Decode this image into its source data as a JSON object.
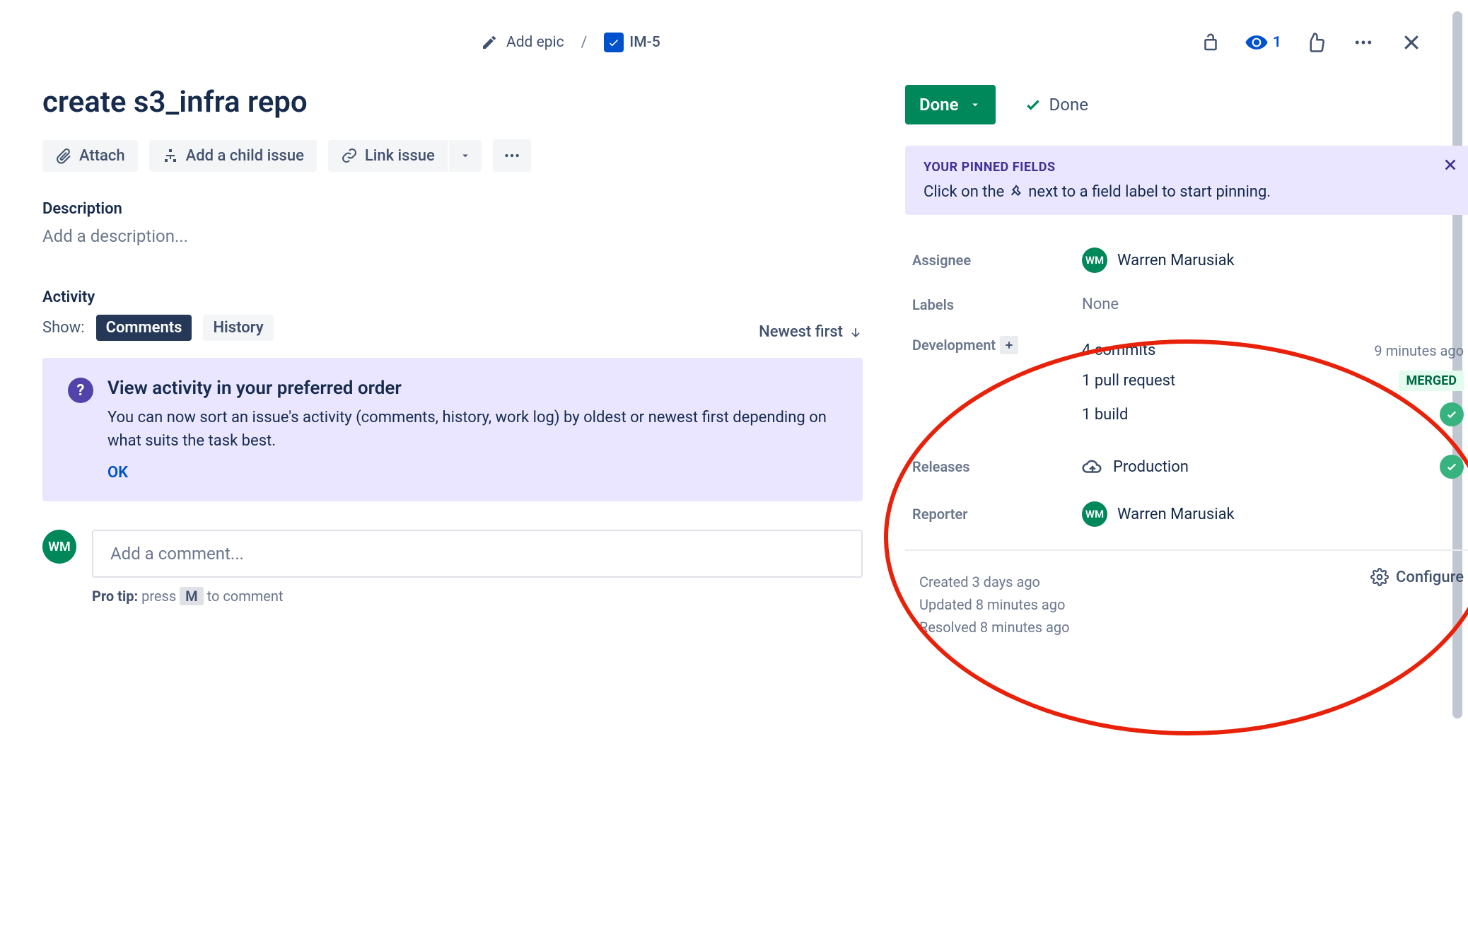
{
  "breadcrumb": {
    "add_epic": "Add epic",
    "issue_key": "IM-5"
  },
  "header_actions": {
    "watch_count": "1"
  },
  "issue": {
    "title": "create s3_infra repo",
    "actions": {
      "attach": "Attach",
      "child": "Add a child issue",
      "link": "Link issue"
    },
    "description_label": "Description",
    "description_placeholder": "Add a description..."
  },
  "activity": {
    "title": "Activity",
    "show_label": "Show:",
    "tabs": {
      "comments": "Comments",
      "history": "History"
    },
    "sort": "Newest first"
  },
  "banner": {
    "title": "View activity in your preferred order",
    "body": "You can now sort an issue's activity (comments, history, work log) by oldest or newest first depending on what suits the task best.",
    "ok": "OK"
  },
  "comment": {
    "avatar_initials": "WM",
    "placeholder": "Add a comment...",
    "protip_prefix": "Pro tip:",
    "protip_press": "press",
    "protip_key": "M",
    "protip_suffix": "to comment"
  },
  "status": {
    "button": "Done",
    "resolution": "Done"
  },
  "pinned": {
    "title": "YOUR PINNED FIELDS",
    "body_before": "Click on the",
    "body_after": "next to a field label to start pinning."
  },
  "fields": {
    "assignee": {
      "label": "Assignee",
      "initials": "WM",
      "name": "Warren Marusiak"
    },
    "labels": {
      "label": "Labels",
      "value": "None"
    },
    "development": {
      "label": "Development",
      "commits": "4 commits",
      "commits_meta": "9 minutes ago",
      "prs": "1 pull request",
      "prs_status": "MERGED",
      "builds": "1 build"
    },
    "releases": {
      "label": "Releases",
      "value": "Production"
    },
    "reporter": {
      "label": "Reporter",
      "initials": "WM",
      "name": "Warren Marusiak"
    }
  },
  "timestamps": {
    "created": "Created 3 days ago",
    "updated": "Updated 8 minutes ago",
    "resolved": "Resolved 8 minutes ago",
    "configure": "Configure"
  }
}
